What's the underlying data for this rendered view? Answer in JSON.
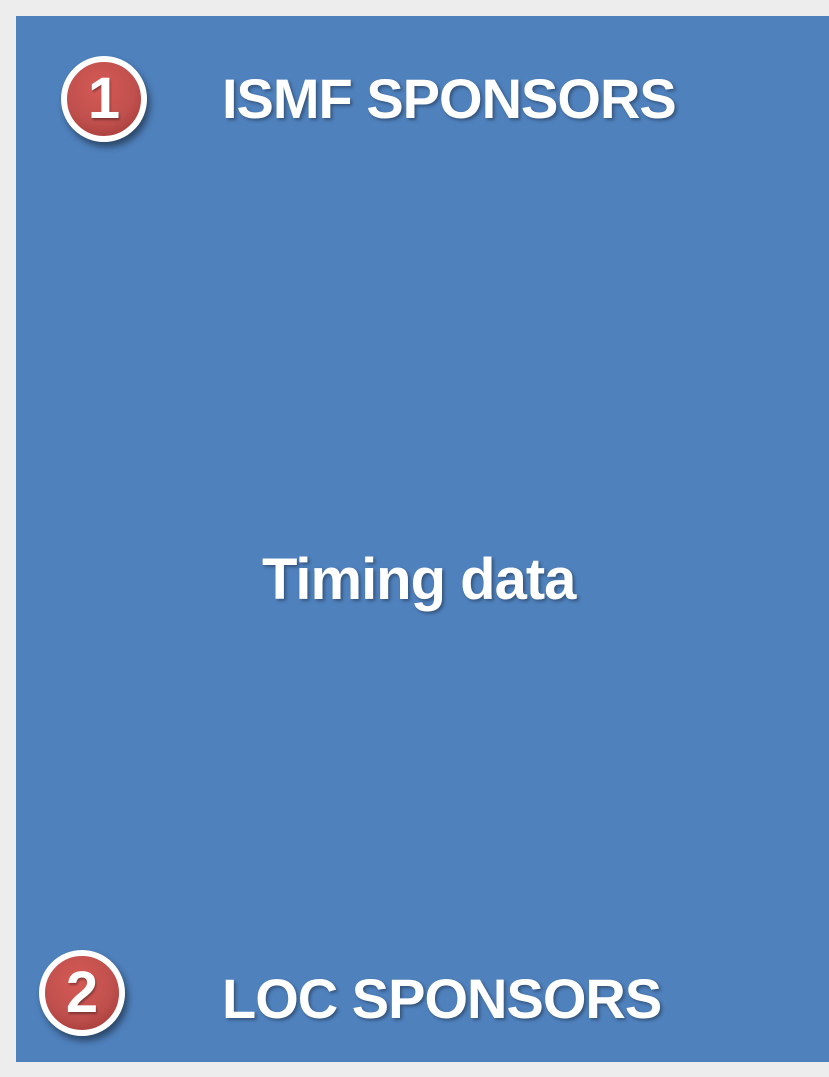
{
  "items": [
    {
      "number": "1",
      "label": "ISMF SPONSORS"
    },
    {
      "number": "2",
      "label": "LOC SPONSORS"
    }
  ],
  "center_text": "Timing data",
  "colors": {
    "panel": "#4f81bd",
    "badge": "#c0504d",
    "text": "#ffffff"
  }
}
